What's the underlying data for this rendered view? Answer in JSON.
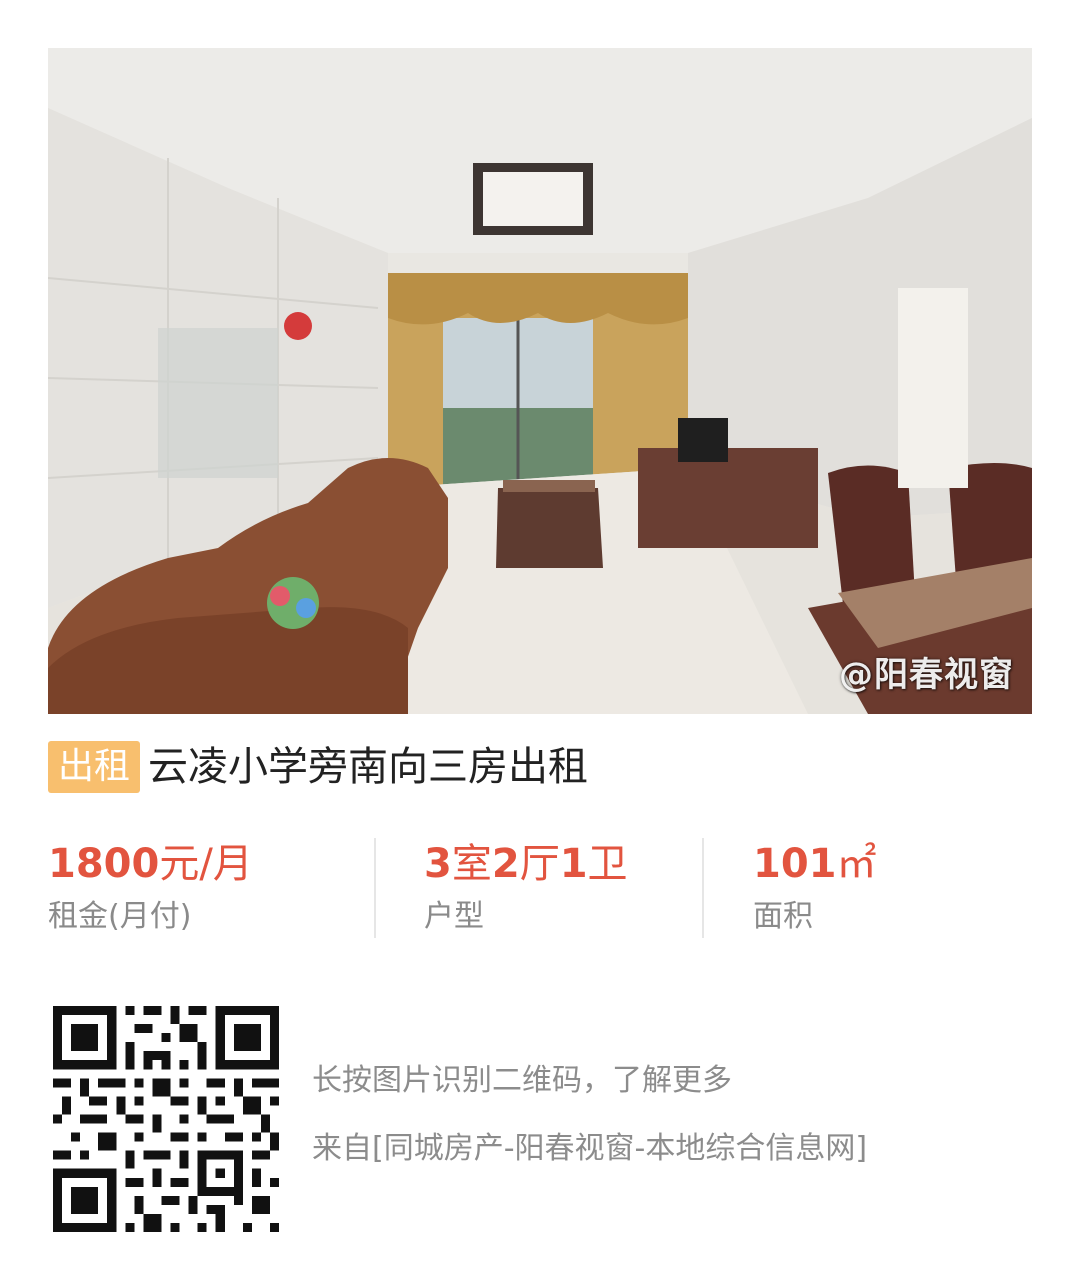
{
  "photo": {
    "watermark": "@阳春视窗",
    "subject": "living-room-photo"
  },
  "listing": {
    "tag": "出租",
    "title": "云凌小学旁南向三房出租"
  },
  "stats": [
    {
      "value_num": "1800",
      "value_unit": "元/月",
      "label": "租金(月付)"
    },
    {
      "value_num": "3",
      "value_unit": "室",
      "value_num2": "2",
      "value_unit2": "厅",
      "value_num3": "1",
      "value_unit3": "卫",
      "label": "户型"
    },
    {
      "value_num": "101",
      "value_unit": "㎡",
      "label": "面积"
    }
  ],
  "footer": {
    "hint": "长按图片识别二维码，了解更多",
    "source": "来自[同城房产-阳春视窗-本地综合信息网]"
  },
  "colors": {
    "tag_bg": "#f8bf6e",
    "accent": "#e2543f",
    "muted": "#8a8a8a"
  }
}
